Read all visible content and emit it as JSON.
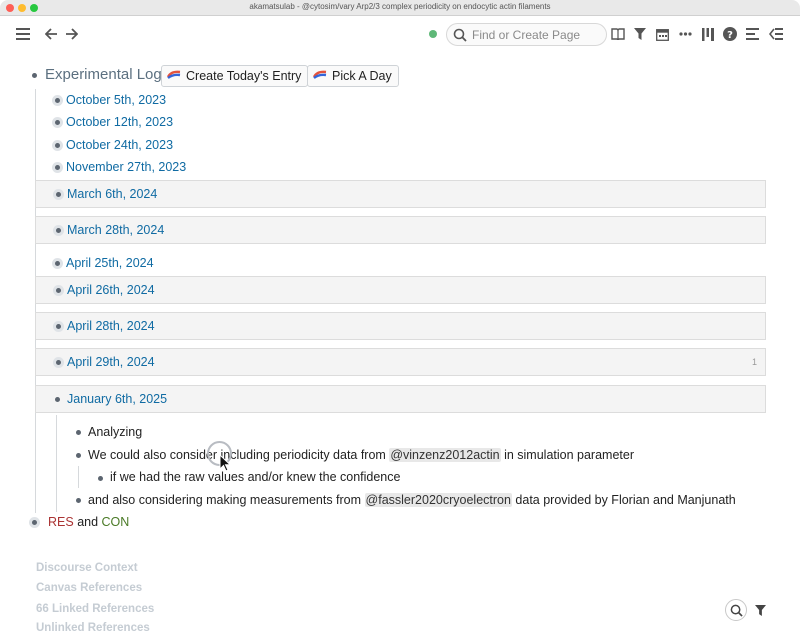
{
  "window": {
    "title": "akamatsulab - @cytosim/vary Arp2/3 complex periodicity on endocytic actin filaments"
  },
  "toolbar": {
    "search_placeholder": "Find or Create Page",
    "icons": [
      "menu-icon",
      "back-arrow-icon",
      "forward-arrow-icon",
      "sync-status-dot",
      "search-icon",
      "book-icon",
      "filter-icon",
      "calendar-icon",
      "more-icon",
      "columns-icon",
      "help-icon",
      "right-sidebar-icon",
      "collapse-sidebar-icon"
    ]
  },
  "page": {
    "heading": "Experimental Log",
    "buttons": {
      "today": "Create Today's Entry",
      "pick_day": "Pick A Day"
    },
    "entries": [
      {
        "date": "October 5th, 2023",
        "boxed": false,
        "count": ""
      },
      {
        "date": "October 12th, 2023",
        "boxed": false,
        "count": ""
      },
      {
        "date": "October 24th, 2023",
        "boxed": false,
        "count": ""
      },
      {
        "date": "November 27th, 2023",
        "boxed": false,
        "count": ""
      },
      {
        "date": "March 6th, 2024",
        "boxed": true,
        "count": ""
      },
      {
        "date": "March 28th, 2024",
        "boxed": true,
        "count": ""
      },
      {
        "date": "April 25th, 2024",
        "boxed": false,
        "count": ""
      },
      {
        "date": "April 26th, 2024",
        "boxed": true,
        "count": ""
      },
      {
        "date": "April 28th, 2024",
        "boxed": true,
        "count": ""
      },
      {
        "date": "April 29th, 2024",
        "boxed": true,
        "count": "1"
      },
      {
        "date": "January 6th, 2025",
        "boxed": true,
        "count": ""
      }
    ],
    "notes": {
      "n1": "Analyzing",
      "n2_pre": "We could also consider including periodicity data from ",
      "n2_ref": "@vinzenz2012actin",
      "n2_post": " in simulation parameter",
      "n3": "if we had the raw values and/or knew the confidence",
      "n4_pre": "and also considering making measurements from ",
      "n4_ref": "@fassler2020cryoelectron",
      "n4_post": " data provided by Florian and Manjunath"
    },
    "res_con": {
      "res": "RES",
      "and": "and",
      "con": "CON"
    }
  },
  "references": {
    "discourse": "Discourse Context",
    "canvas": "Canvas References",
    "linked": "66 Linked References",
    "unlinked": "Unlinked References"
  },
  "colors": {
    "link": "#106ba3",
    "heading": "#5c7080",
    "res": "#aa3333",
    "con": "#4a7a26"
  }
}
